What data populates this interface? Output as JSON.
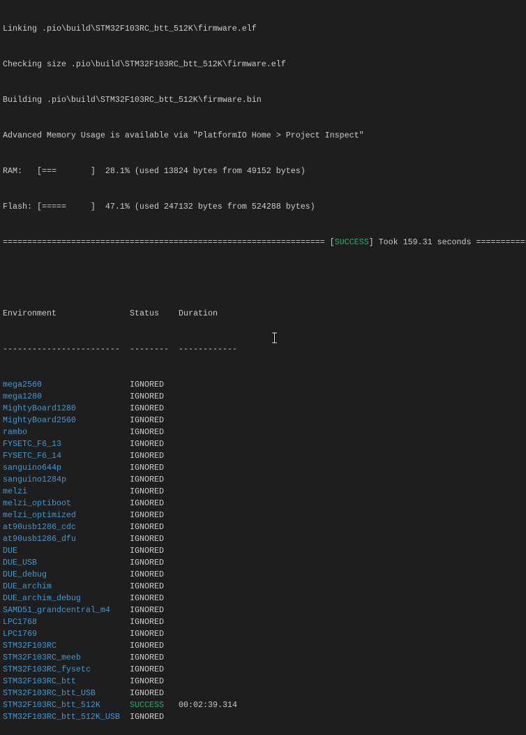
{
  "log": [
    "Linking .pio\\build\\STM32F103RC_btt_512K\\firmware.elf",
    "Checking size .pio\\build\\STM32F103RC_btt_512K\\firmware.elf",
    "Building .pio\\build\\STM32F103RC_btt_512K\\firmware.bin",
    "Advanced Memory Usage is available via \"PlatformIO Home > Project Inspect\"",
    "RAM:   [===       ]  28.1% (used 13824 bytes from 49152 bytes)",
    "Flash: [=====     ]  47.1% (used 247132 bytes from 524288 bytes)"
  ],
  "summary": {
    "left_rule": "================================================================== ",
    "bracket_open": "[",
    "status": "SUCCESS",
    "bracket_close": "]",
    "took": " Took 159.31 seconds ==========="
  },
  "table": {
    "headers": [
      "Environment",
      "Status",
      "Duration"
    ],
    "rules": [
      "------------------------",
      "--------",
      "------------"
    ],
    "rows": [
      {
        "env": "mega2560",
        "status": "IGNORED",
        "duration": ""
      },
      {
        "env": "mega1280",
        "status": "IGNORED",
        "duration": ""
      },
      {
        "env": "MightyBoard1280",
        "status": "IGNORED",
        "duration": ""
      },
      {
        "env": "MightyBoard2560",
        "status": "IGNORED",
        "duration": ""
      },
      {
        "env": "rambo",
        "status": "IGNORED",
        "duration": ""
      },
      {
        "env": "FYSETC_F6_13",
        "status": "IGNORED",
        "duration": ""
      },
      {
        "env": "FYSETC_F6_14",
        "status": "IGNORED",
        "duration": ""
      },
      {
        "env": "sanguino644p",
        "status": "IGNORED",
        "duration": ""
      },
      {
        "env": "sanguino1284p",
        "status": "IGNORED",
        "duration": ""
      },
      {
        "env": "melzi",
        "status": "IGNORED",
        "duration": ""
      },
      {
        "env": "melzi_optiboot",
        "status": "IGNORED",
        "duration": ""
      },
      {
        "env": "melzi_optimized",
        "status": "IGNORED",
        "duration": ""
      },
      {
        "env": "at90usb1286_cdc",
        "status": "IGNORED",
        "duration": ""
      },
      {
        "env": "at90usb1286_dfu",
        "status": "IGNORED",
        "duration": ""
      },
      {
        "env": "DUE",
        "status": "IGNORED",
        "duration": ""
      },
      {
        "env": "DUE_USB",
        "status": "IGNORED",
        "duration": ""
      },
      {
        "env": "DUE_debug",
        "status": "IGNORED",
        "duration": ""
      },
      {
        "env": "DUE_archim",
        "status": "IGNORED",
        "duration": ""
      },
      {
        "env": "DUE_archim_debug",
        "status": "IGNORED",
        "duration": ""
      },
      {
        "env": "SAMD51_grandcentral_m4",
        "status": "IGNORED",
        "duration": ""
      },
      {
        "env": "LPC1768",
        "status": "IGNORED",
        "duration": ""
      },
      {
        "env": "LPC1769",
        "status": "IGNORED",
        "duration": ""
      },
      {
        "env": "STM32F103RC",
        "status": "IGNORED",
        "duration": ""
      },
      {
        "env": "STM32F103RC_meeb",
        "status": "IGNORED",
        "duration": ""
      },
      {
        "env": "STM32F103RC_fysetc",
        "status": "IGNORED",
        "duration": ""
      },
      {
        "env": "STM32F103RC_btt",
        "status": "IGNORED",
        "duration": ""
      },
      {
        "env": "STM32F103RC_btt_USB",
        "status": "IGNORED",
        "duration": ""
      },
      {
        "env": "STM32F103RC_btt_512K",
        "status": "SUCCESS",
        "duration": "00:02:39.314"
      },
      {
        "env": "STM32F103RC_btt_512K_USB",
        "status": "IGNORED",
        "duration": ""
      }
    ]
  },
  "colors": {
    "background": "#1e1e1e",
    "text": "#cccccc",
    "env": "#3a9bd8",
    "success": "#23b06f"
  }
}
